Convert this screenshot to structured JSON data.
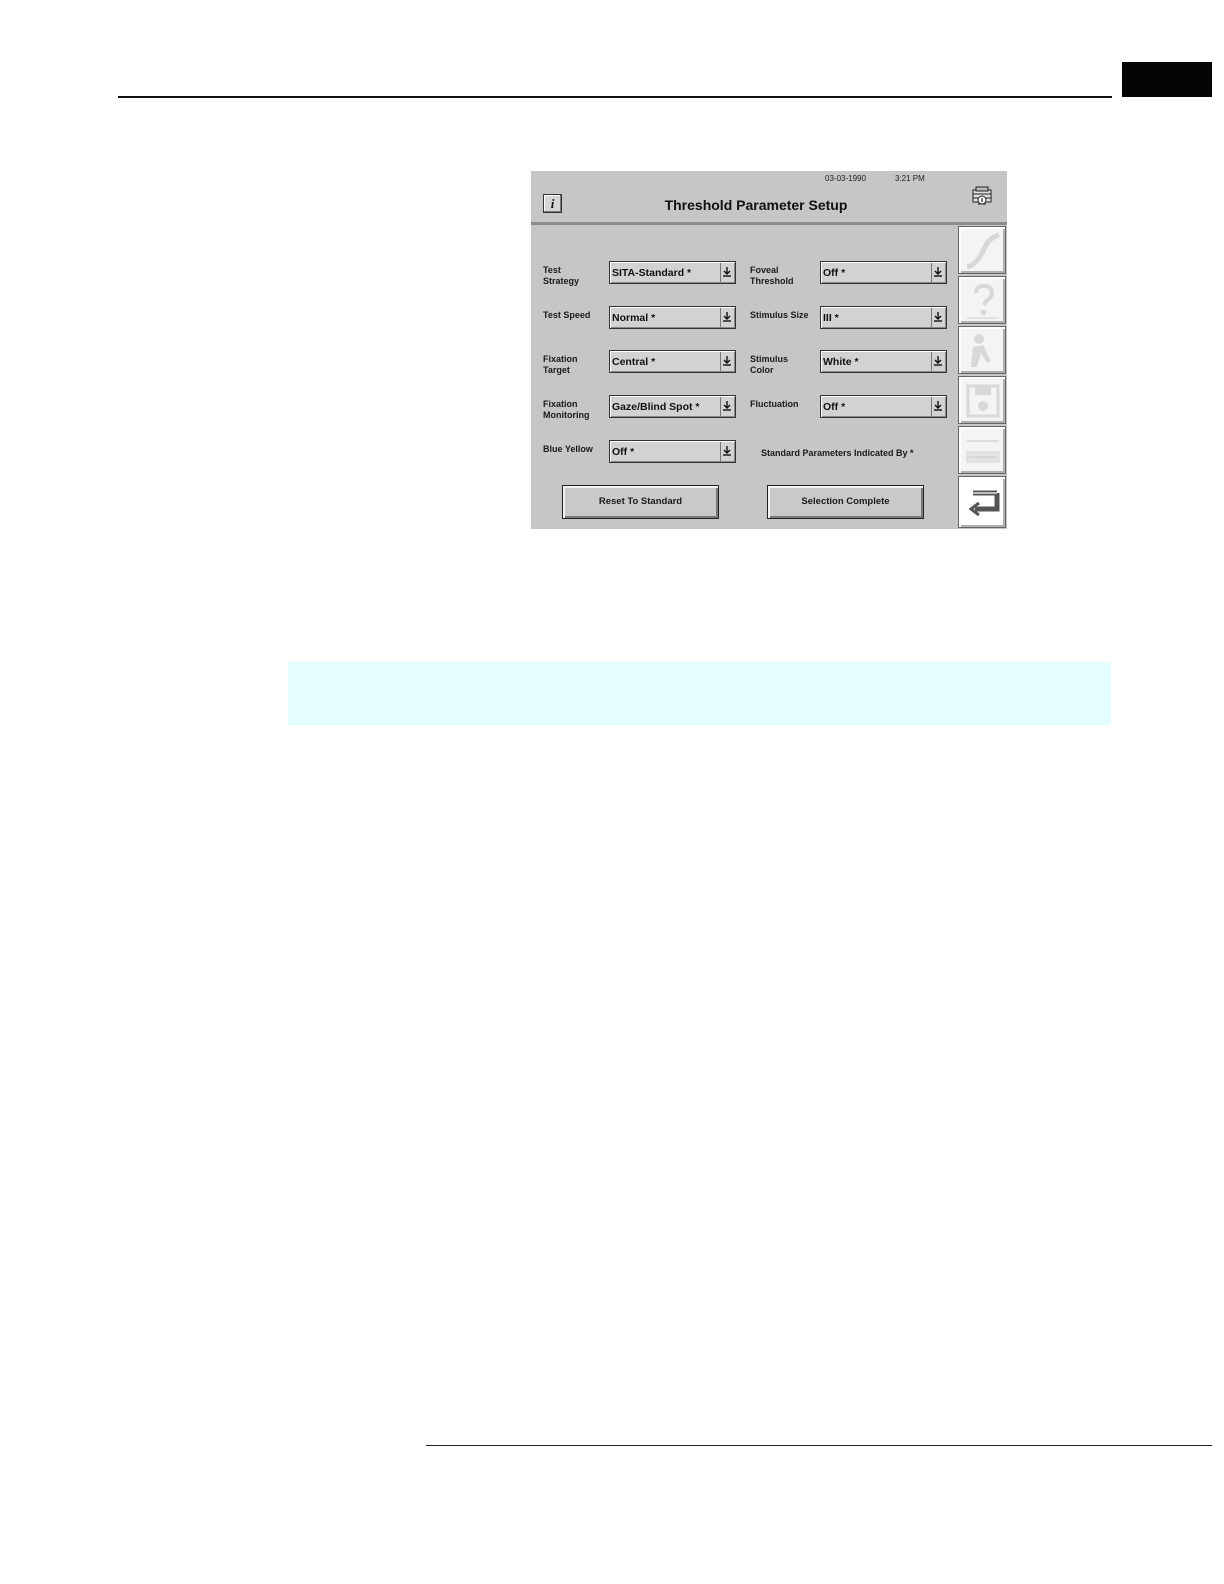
{
  "screen": {
    "title": "Threshold Parameter Setup",
    "date": "03-03-1990",
    "time": "3:21 PM",
    "info_label": "i",
    "fields": [
      {
        "label_lines": [
          "Test",
          "Strategy"
        ],
        "value": "SITA-Standard *"
      },
      {
        "label_lines": [
          "Test Speed"
        ],
        "value": "Normal *"
      },
      {
        "label_lines": [
          "Fixation",
          "Target"
        ],
        "value": "Central *"
      },
      {
        "label_lines": [
          "Fixation",
          "Monitoring"
        ],
        "value": "Gaze/Blind Spot *"
      },
      {
        "label_lines": [
          "Blue Yellow"
        ],
        "value": "Off *"
      },
      {
        "label_lines": [
          "Foveal",
          "Threshold"
        ],
        "value": "Off *"
      },
      {
        "label_lines": [
          "Stimulus Size"
        ],
        "value": "III *"
      },
      {
        "label_lines": [
          "Stimulus",
          "Color"
        ],
        "value": "White *"
      },
      {
        "label_lines": [
          "Fluctuation"
        ],
        "value": "Off *"
      }
    ],
    "standard_note": "Standard Parameters Indicated By *",
    "reset_label": "Reset To Standard",
    "complete_label": "Selection Complete",
    "side_icons": [
      "curve-icon",
      "help-question-icon",
      "person-icon",
      "save-disk-icon",
      "printer-icon",
      "return-arrow-icon"
    ]
  }
}
